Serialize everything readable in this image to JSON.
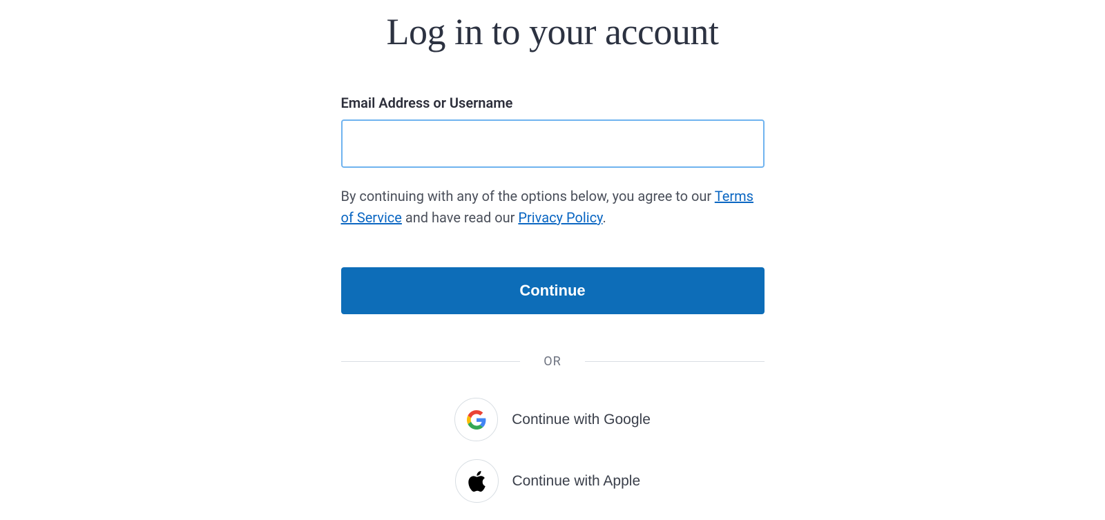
{
  "title": "Log in to your account",
  "email": {
    "label": "Email Address or Username",
    "value": ""
  },
  "consent": {
    "prefix": "By continuing with any of the options below, you agree to our ",
    "tos_label": "Terms of Service",
    "middle": " and have read our ",
    "privacy_label": "Privacy Policy",
    "suffix": "."
  },
  "continue_label": "Continue",
  "divider_label": "OR",
  "social": {
    "google_label": "Continue with Google",
    "apple_label": "Continue with Apple"
  }
}
